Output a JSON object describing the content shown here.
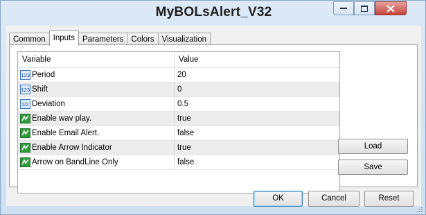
{
  "window": {
    "title": "MyBOLsAlert_V32",
    "controls": [
      "minimize-icon",
      "maximize-icon",
      "close-icon"
    ]
  },
  "tabs": [
    "Common",
    "Inputs",
    "Parameters",
    "Colors",
    "Visualization"
  ],
  "active_tab": "Inputs",
  "grid": {
    "headers": {
      "variable": "Variable",
      "value": "Value"
    },
    "rows": [
      {
        "icon": "integer-icon",
        "icon_text": "123",
        "variable": "Period",
        "value": "20"
      },
      {
        "icon": "integer-icon",
        "icon_text": "123",
        "variable": "Shift",
        "value": "0"
      },
      {
        "icon": "double-icon",
        "icon_text": "1/2",
        "variable": "Deviation",
        "value": "0.5"
      },
      {
        "icon": "bool-icon",
        "icon_text": "",
        "variable": "Enable wav play.",
        "value": "true"
      },
      {
        "icon": "bool-icon",
        "icon_text": "",
        "variable": "Enable Email Alert.",
        "value": "false"
      },
      {
        "icon": "bool-icon",
        "icon_text": "",
        "variable": "Enable Arrow Indicator",
        "value": "true"
      },
      {
        "icon": "bool-icon",
        "icon_text": "",
        "variable": "Arrow on BandLine Only",
        "value": "false"
      }
    ]
  },
  "side_buttons": {
    "load": "Load",
    "save": "Save"
  },
  "footer_buttons": {
    "ok": "OK",
    "cancel": "Cancel",
    "reset": "Reset"
  }
}
